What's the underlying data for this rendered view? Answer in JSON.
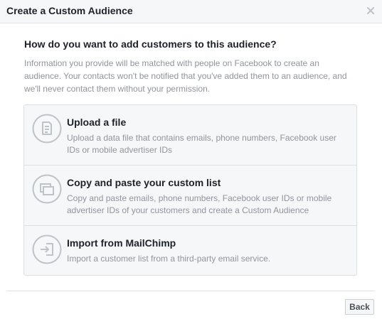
{
  "dialog": {
    "title": "Create a Custom Audience"
  },
  "main": {
    "question": "How do you want to add customers to this audience?",
    "info": "Information you provide will be matched with people on Facebook to create an audience. Your contacts won't be notified that you've added them to an audience, and we'll never contact them without your permission."
  },
  "options": [
    {
      "title": "Upload a file",
      "description": "Upload a data file that contains emails, phone numbers, Facebook user IDs or mobile advertiser IDs",
      "icon": "file-icon"
    },
    {
      "title": "Copy and paste your custom list",
      "description": "Copy and paste emails, phone numbers, Facebook user IDs or mobile advertiser IDs of your customers and create a Custom Audience",
      "icon": "copy-paste-icon"
    },
    {
      "title": "Import from MailChimp",
      "description": "Import a customer list from a third-party email service.",
      "icon": "import-icon"
    }
  ],
  "footer": {
    "back_label": "Back"
  },
  "colors": {
    "header_bg": "#f6f7f9",
    "options_bg": "#f6f7f9",
    "border": "#dddfe2",
    "text_primary": "#1d2129",
    "text_secondary": "#90949c"
  }
}
